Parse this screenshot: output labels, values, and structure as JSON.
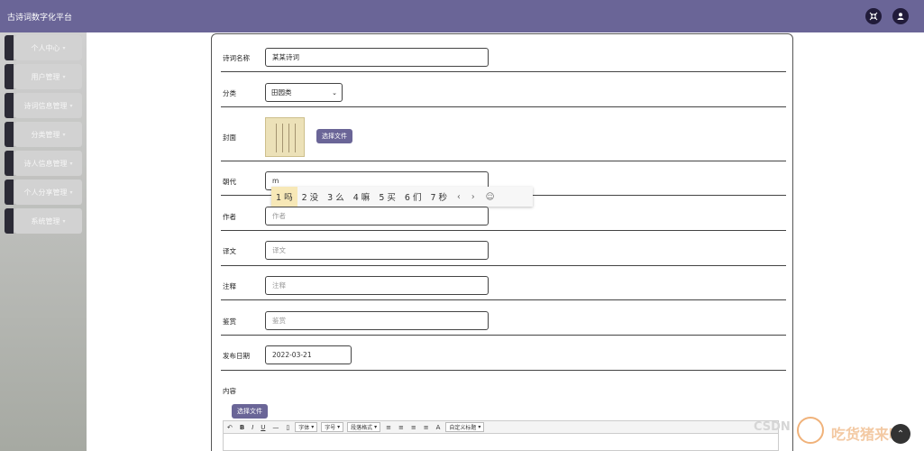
{
  "app": {
    "title": "古诗词数字化平台"
  },
  "topbar": {
    "fullscreen_icon": "shrink-arrows-icon",
    "user_icon": "user-icon"
  },
  "sidebar": {
    "items": [
      {
        "label": "个人中心"
      },
      {
        "label": "用户管理"
      },
      {
        "label": "诗词信息管理"
      },
      {
        "label": "分类管理"
      },
      {
        "label": "诗人信息管理"
      },
      {
        "label": "个人分享管理"
      },
      {
        "label": "系统管理"
      }
    ],
    "caret_icon": "caret-down-icon"
  },
  "form": {
    "title_label": "诗词名称",
    "title_value": "某某诗词",
    "category_label": "分类",
    "category_value": "田园类",
    "cover_label": "封面",
    "choose_file": "选择文件",
    "dynasty_label": "朝代",
    "dynasty_value": "m",
    "author_label": "作者",
    "author_placeholder": "作者",
    "translation_label": "译文",
    "translation_placeholder": "译文",
    "notes_label": "注释",
    "notes_placeholder": "注释",
    "appreciation_label": "鉴赏",
    "appreciation_placeholder": "鉴赏",
    "date_label": "发布日期",
    "date_value": "2022-03-21",
    "content_label": "内容",
    "content_choose_file": "选择文件"
  },
  "ime": {
    "candidates": [
      "1 吗",
      "2 没",
      "3 么",
      "4 嘛",
      "5 买",
      "6 们",
      "7 秒"
    ],
    "prev_icon": "chevron-left-icon",
    "next_icon": "chevron-right-icon",
    "emoji_icon": "smiley-icon"
  },
  "editor_toolbar": {
    "bold": "B",
    "italic": "I",
    "underline": "U",
    "font_family": "字体",
    "font_size": "字号",
    "paragraph": "段落格式",
    "custom_title": "自定义标题",
    "color_letter": "A"
  },
  "watermark": {
    "csdn": "CSDN",
    "brand": "吃货猪来啦"
  }
}
